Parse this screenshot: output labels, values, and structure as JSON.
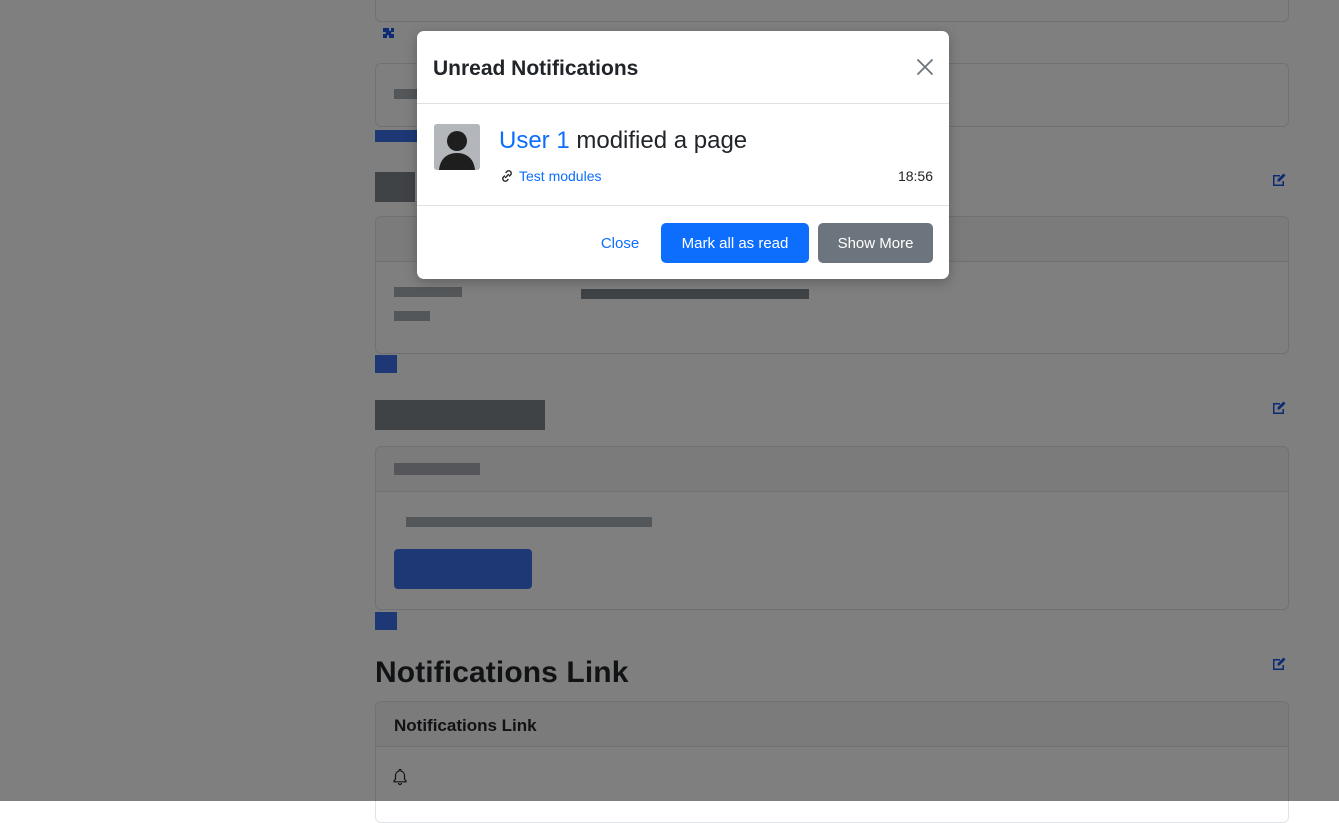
{
  "modal": {
    "title": "Unread Notifications",
    "close_icon": "close-icon",
    "notification": {
      "avatar_icon": "user-silhouette-icon",
      "user": "User 1",
      "action": "modified a page",
      "link_icon": "link-icon",
      "link_text": "Test modules",
      "time": "18:56"
    },
    "footer": {
      "close_label": "Close",
      "mark_read_label": "Mark all as read",
      "show_more_label": "Show More"
    }
  },
  "page": {
    "sections": [
      {
        "title": "Notifications Link",
        "card_header": "Notifications Link",
        "icon": "bell-icon"
      }
    ],
    "edit_icon": "edit-icon"
  },
  "colors": {
    "primary": "#0d6efd",
    "secondary": "#6c757d",
    "backdrop": "rgba(0,0,0,0.5)"
  }
}
